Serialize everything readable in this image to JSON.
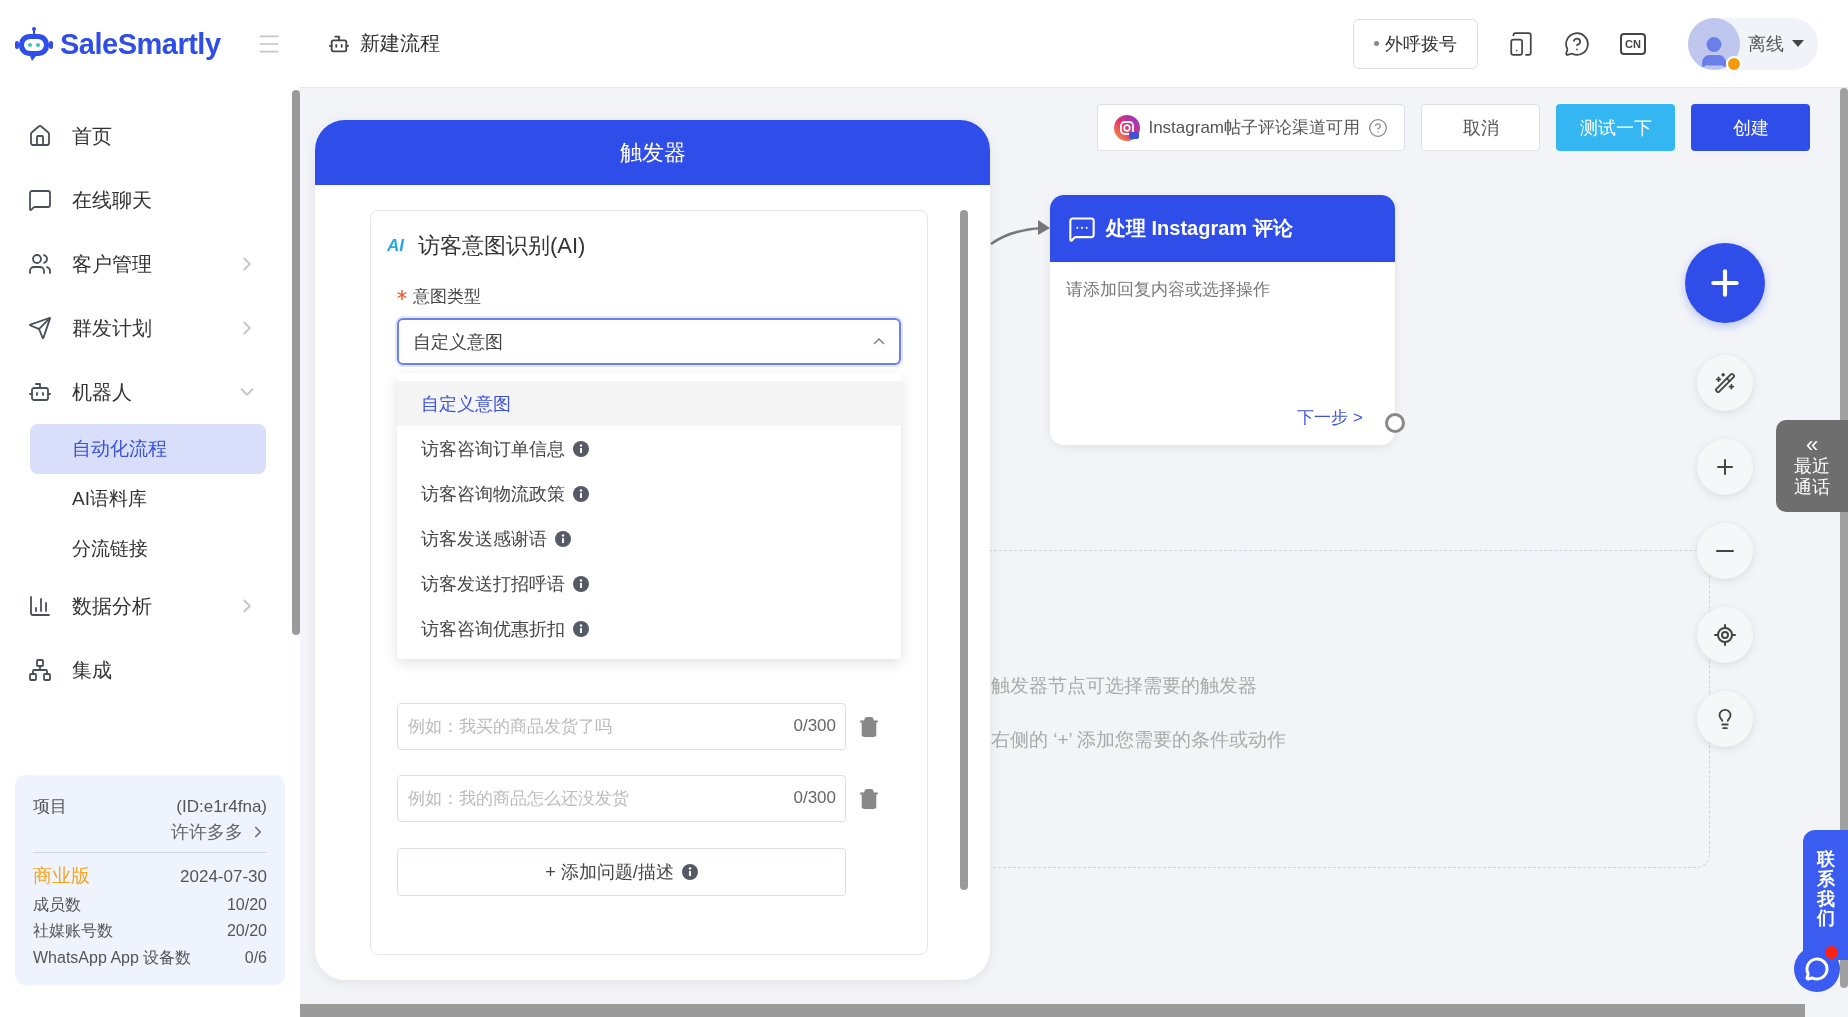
{
  "logo": {
    "text": "SaleSmartly"
  },
  "sidebar": {
    "items": [
      {
        "label": "首页",
        "kind": "link",
        "selected": false
      },
      {
        "label": "在线聊天",
        "kind": "link",
        "selected": false
      },
      {
        "label": "客户管理",
        "kind": "group",
        "expanded": false
      },
      {
        "label": "群发计划",
        "kind": "group",
        "expanded": false
      },
      {
        "label": "机器人",
        "kind": "group",
        "expanded": true,
        "children": [
          {
            "label": "自动化流程",
            "selected": true
          },
          {
            "label": "AI语料库",
            "selected": false
          },
          {
            "label": "分流链接",
            "selected": false
          }
        ]
      },
      {
        "label": "数据分析",
        "kind": "group",
        "expanded": false
      },
      {
        "label": "集成",
        "kind": "link",
        "selected": false
      }
    ]
  },
  "project": {
    "label": "项目",
    "id": "(ID:e1r4fna)",
    "name": "许许多多",
    "plan": "商业版",
    "expiry": "2024-07-30",
    "stats": [
      {
        "label": "成员数",
        "value": "10/20"
      },
      {
        "label": "社媒账号数",
        "value": "20/20"
      },
      {
        "label": "WhatsApp App 设备数",
        "value": "0/6"
      }
    ]
  },
  "header": {
    "title": "新建流程",
    "call_button": "外呼拨号",
    "language": "CN",
    "user_status": "离线"
  },
  "toolbar": {
    "channel_notice": "Instagram帖子评论渠道可用",
    "buttons": [
      {
        "label": "取消",
        "kind": "default"
      },
      {
        "label": "测试一下",
        "kind": "test"
      },
      {
        "label": "创建",
        "kind": "primary"
      }
    ]
  },
  "trigger_panel": {
    "title": "触发器",
    "badge": "AI",
    "section_title": "访客意图识别(AI)",
    "field_label": "意图类型",
    "required": true,
    "select": {
      "value": "自定义意图",
      "expanded": true
    },
    "options": [
      {
        "label": "自定义意图",
        "selected": true,
        "info": false
      },
      {
        "label": "访客咨询订单信息",
        "selected": false,
        "info": true
      },
      {
        "label": "访客咨询物流政策",
        "selected": false,
        "info": true
      },
      {
        "label": "访客发送感谢语",
        "selected": false,
        "info": true
      },
      {
        "label": "访客发送打招呼语",
        "selected": false,
        "info": true
      },
      {
        "label": "访客咨询优惠折扣",
        "selected": false,
        "info": true
      }
    ],
    "questions": [
      {
        "placeholder": "例如：我买的商品发货了吗",
        "counter": "0/300"
      },
      {
        "placeholder": "例如：我的商品怎么还没发货",
        "counter": "0/300"
      }
    ],
    "add_button": "+ 添加问题/描述"
  },
  "node": {
    "title": "处理 Instagram 评论",
    "placeholder": "请添加回复内容或选择操作",
    "next": "下一步 >"
  },
  "hint": {
    "lines": [
      "触发器节点可选择需要的触发器",
      "右侧的 ‘+’ 添加您需要的条件或动作"
    ]
  },
  "side_tabs": {
    "recent_arrow": "«",
    "recent_label": "最近通话",
    "contact_label": "联系我们"
  }
}
